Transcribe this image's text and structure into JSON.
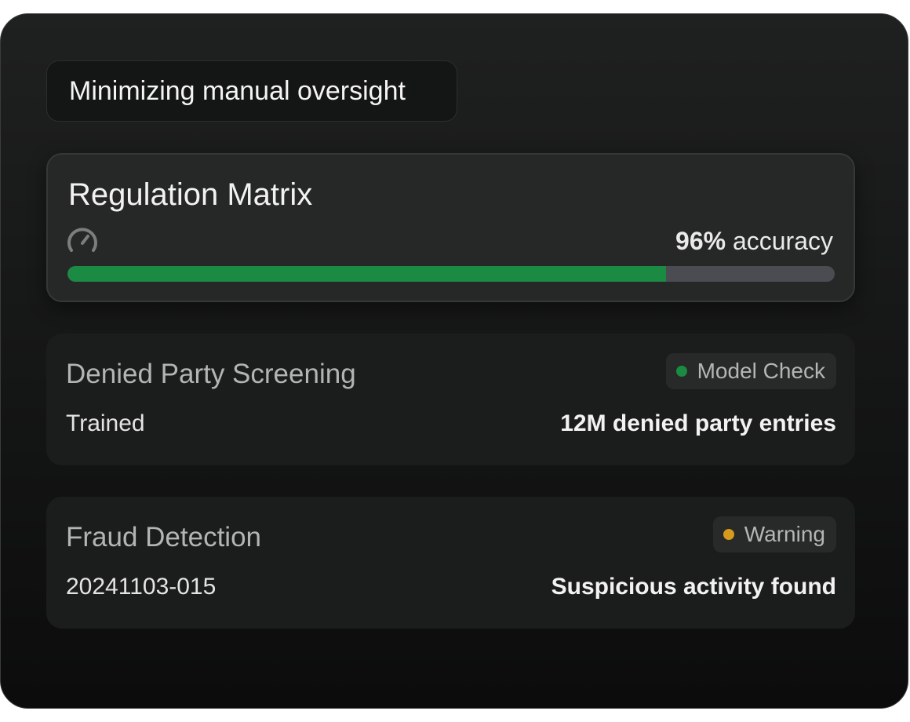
{
  "header": {
    "title": "Minimizing manual oversight"
  },
  "regulation_matrix": {
    "title": "Regulation Matrix",
    "accuracy_value": "96%",
    "accuracy_label": "accuracy",
    "progress_fraction": 0.78,
    "progress_color": "#1b8a43",
    "icon": "gauge-icon"
  },
  "cards": [
    {
      "title": "Denied Party Screening",
      "badge_label": "Model Check",
      "badge_dot_color": "#1b8a43",
      "left_text": "Trained",
      "right_text": "12M denied party entries"
    },
    {
      "title": "Fraud Detection",
      "badge_label": "Warning",
      "badge_dot_color": "#d69a1c",
      "left_text": "20241103-015",
      "right_text": "Suspicious activity found"
    }
  ]
}
